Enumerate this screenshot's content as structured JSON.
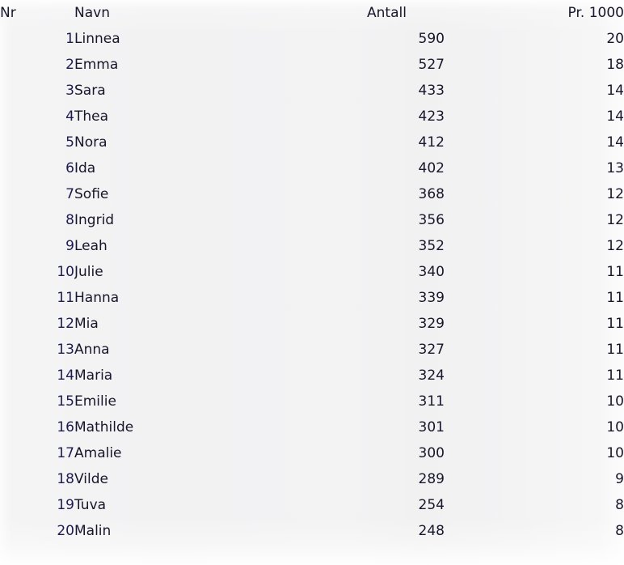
{
  "table": {
    "columns": [
      {
        "key": "nr",
        "label": "Nr",
        "align": "right"
      },
      {
        "key": "navn",
        "label": "Navn",
        "align": "left"
      },
      {
        "key": "antall",
        "label": "Antall",
        "align": "right"
      },
      {
        "key": "pr1000",
        "label": "Pr. 1000",
        "align": "right"
      }
    ],
    "rows": [
      {
        "nr": "1",
        "navn": "Linnea",
        "antall": "590",
        "pr1000": "20"
      },
      {
        "nr": "2",
        "navn": "Emma",
        "antall": "527",
        "pr1000": "18"
      },
      {
        "nr": "3",
        "navn": "Sara",
        "antall": "433",
        "pr1000": "14"
      },
      {
        "nr": "4",
        "navn": "Thea",
        "antall": "423",
        "pr1000": "14"
      },
      {
        "nr": "5",
        "navn": "Nora",
        "antall": "412",
        "pr1000": "14"
      },
      {
        "nr": "6",
        "navn": "Ida",
        "antall": "402",
        "pr1000": "13"
      },
      {
        "nr": "7",
        "navn": "Sofie",
        "antall": "368",
        "pr1000": "12"
      },
      {
        "nr": "8",
        "navn": "Ingrid",
        "antall": "356",
        "pr1000": "12"
      },
      {
        "nr": "9",
        "navn": "Leah",
        "antall": "352",
        "pr1000": "12"
      },
      {
        "nr": "10",
        "navn": "Julie",
        "antall": "340",
        "pr1000": "11"
      },
      {
        "nr": "11",
        "navn": "Hanna",
        "antall": "339",
        "pr1000": "11"
      },
      {
        "nr": "12",
        "navn": "Mia",
        "antall": "329",
        "pr1000": "11"
      },
      {
        "nr": "13",
        "navn": "Anna",
        "antall": "327",
        "pr1000": "11"
      },
      {
        "nr": "14",
        "navn": "Maria",
        "antall": "324",
        "pr1000": "11"
      },
      {
        "nr": "15",
        "navn": "Emilie",
        "antall": "311",
        "pr1000": "10"
      },
      {
        "nr": "16",
        "navn": "Mathilde",
        "antall": "301",
        "pr1000": "10"
      },
      {
        "nr": "17",
        "navn": "Amalie",
        "antall": "300",
        "pr1000": "10"
      },
      {
        "nr": "18",
        "navn": "Vilde",
        "antall": "289",
        "pr1000": "9"
      },
      {
        "nr": "19",
        "navn": "Tuva",
        "antall": "254",
        "pr1000": "8"
      },
      {
        "nr": "20",
        "navn": "Malin",
        "antall": "248",
        "pr1000": "8"
      }
    ]
  },
  "colors": {
    "background": "#f2f2f3",
    "text": "#16162c",
    "rank_text": "#1b1b52"
  }
}
